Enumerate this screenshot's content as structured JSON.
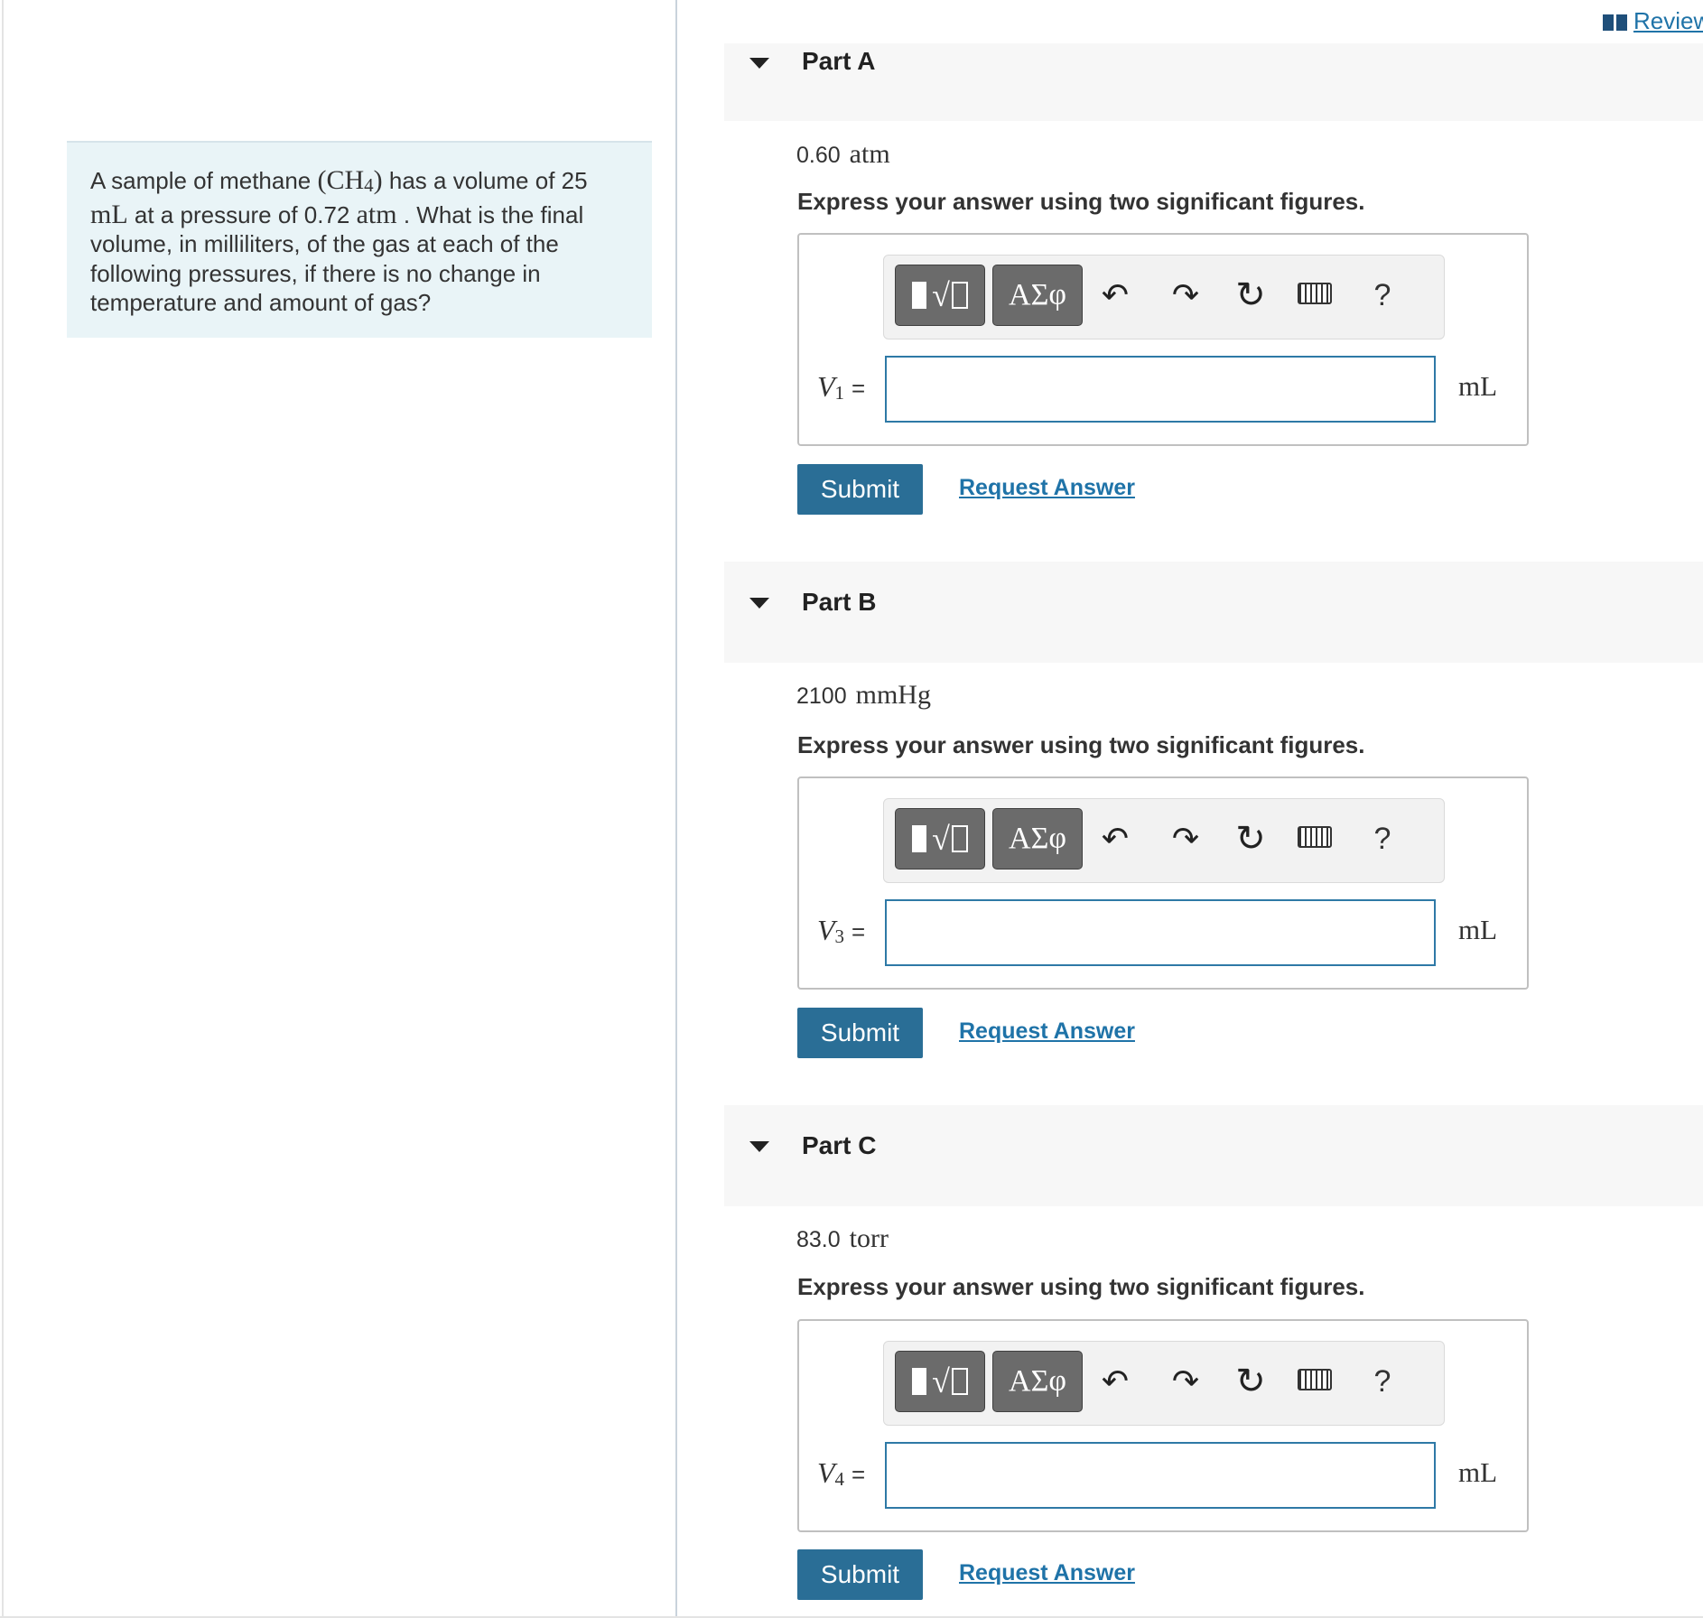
{
  "problem": {
    "text_1": "A sample of methane ",
    "formula_open": "(CH",
    "formula_sub": "4",
    "formula_close": ")",
    "text_2": " has a volume of 25",
    "unit_ml": "mL",
    "text_3": " at a pressure of 0.72 ",
    "unit_atm": "atm",
    "text_4": " . What is the final volume, in milliliters, of the gas at each of the following pressures, if there is no change in temperature and amount of gas?"
  },
  "review": {
    "label": "Review"
  },
  "parts": [
    {
      "title": "Part A",
      "given_value": "0.60",
      "given_unit": "atm",
      "instruction": "Express your answer using two significant figures.",
      "var_letter": "V",
      "var_sub": "1",
      "equals": "=",
      "input_value": "",
      "unit": "mL",
      "submit_label": "Submit",
      "request_label": "Request Answer"
    },
    {
      "title": "Part B",
      "given_value": "2100",
      "given_unit": "mmHg",
      "instruction": "Express your answer using two significant figures.",
      "var_letter": "V",
      "var_sub": "3",
      "equals": "=",
      "input_value": "",
      "unit": "mL",
      "submit_label": "Submit",
      "request_label": "Request Answer"
    },
    {
      "title": "Part C",
      "given_value": "83.0",
      "given_unit": "torr",
      "instruction": "Express your answer using two significant figures.",
      "var_letter": "V",
      "var_sub": "4",
      "equals": "=",
      "input_value": "",
      "unit": "mL",
      "submit_label": "Submit",
      "request_label": "Request Answer"
    }
  ],
  "toolbar": {
    "greek_label": "ΑΣφ",
    "root_symbol": "√",
    "undo_glyph": "↶",
    "redo_glyph": "↷",
    "reset_glyph": "↻",
    "help_label": "?",
    "icons": [
      "templates-icon",
      "greek-symbols-icon",
      "undo-icon",
      "redo-icon",
      "reset-icon",
      "keyboard-icon",
      "help-icon"
    ]
  },
  "colors": {
    "problem_bg": "#e9f4f7",
    "accent_blue": "#2a6e96",
    "link_blue": "#1f73a8",
    "input_border": "#2e79a6"
  }
}
